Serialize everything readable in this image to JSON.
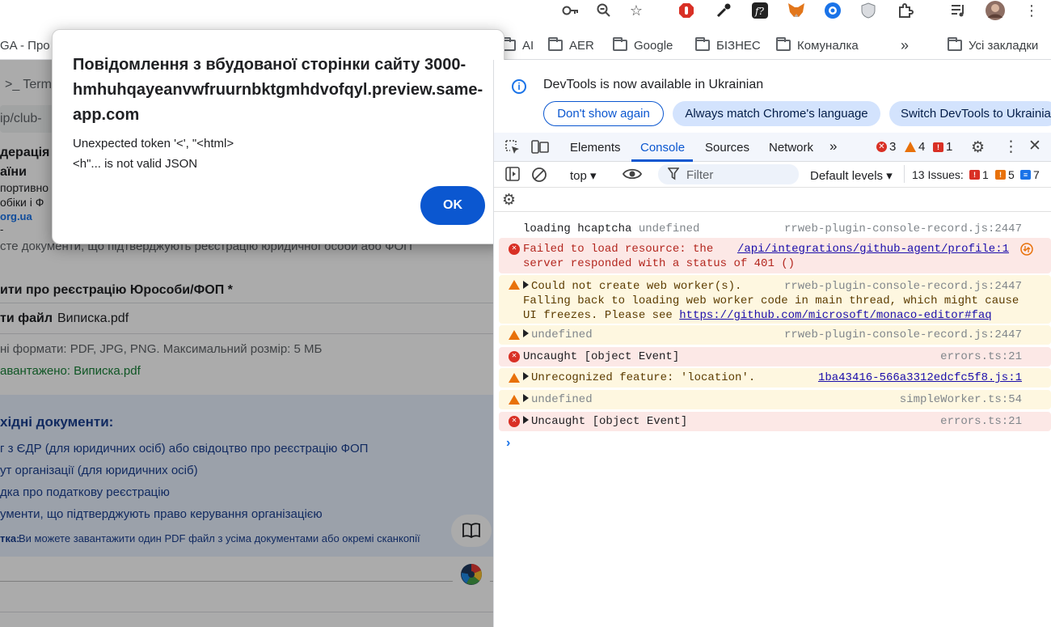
{
  "bookmarks": {
    "partial_left": "GA - Про",
    "items": [
      "AI",
      "AER",
      "Google",
      "БІЗНЕС",
      "Комуналка"
    ],
    "overflow": "»",
    "all": "Усі закладки"
  },
  "left_page": {
    "terminal_tab": ">_ Term",
    "url_partial": "ip/club-",
    "org_line1": "дерація",
    "org_line2": "аїни",
    "org_line3": "портивно",
    "org_line4": "обіки і Ф",
    "org_link": "org.ua",
    "dash": "-",
    "desc": "сте документи, що підтверджують реєстрацію юридичної особи або ФОП",
    "field_label": "ити про реєстрацію Юрособи/ФОП *",
    "file_label": "ти файл",
    "file_name": "Виписка.pdf",
    "formats": "ні формати: PDF, JPG, PNG. Максимальний розмір: 5 МБ",
    "uploaded": "авантажено: Виписка.pdf",
    "required_title": "хідні документи:",
    "req_items": [
      "г з ЄДР (для юридичних осіб) або свідоцтво про реєстрацію ФОП",
      "ут організації (для юридичних осіб)",
      "дка про податкову реєстрацію",
      "ументи, що підтверджують право керування організацією"
    ],
    "note_bold": "тка:",
    "note_text": "Ви можете завантажити один PDF файл з усіма документами або окремі сканкопії"
  },
  "dialog": {
    "title": "Повідомлення з вбудованої сторінки сайту 3000-hmhuhqayeanvwfruurnbktgmhdvofqyl.preview.same-app.com",
    "message": "Unexpected token '<', \"<html>\n<h\"... is not valid JSON",
    "ok_label": "OK"
  },
  "devtools": {
    "info_text": "DevTools is now available in Ukrainian",
    "btn_dont_show": "Don't show again",
    "btn_always_match": "Always match Chrome's language",
    "btn_switch": "Switch DevTools to Ukrainian",
    "tabs": [
      "Elements",
      "Console",
      "Sources",
      "Network"
    ],
    "active_tab": "Console",
    "error_count": "3",
    "warning_count": "4",
    "issue_count": "1",
    "context": "top",
    "filter_placeholder": "Filter",
    "levels": "Default levels",
    "issues_label": "13 Issues:",
    "issues_red": "1",
    "issues_orange": "5",
    "issues_blue": "7"
  },
  "console": [
    {
      "level": "info",
      "text": "loading hcaptcha",
      "grey": "undefined",
      "source": "rrweb-plugin-console-record.js:2447"
    },
    {
      "level": "error",
      "text": "Failed to load resource: the",
      "text2": "server responded with a status of 401 ()",
      "link": "/api/integrations/github-agent/profile:1"
    },
    {
      "level": "warn",
      "text": "Could not create web worker(s).",
      "text2": "Falling back to loading web worker code in main thread, which might cause",
      "text3": "UI freezes. Please see ",
      "link": "https://github.com/microsoft/monaco-editor#faq",
      "source": "rrweb-plugin-console-record.js:2447"
    },
    {
      "level": "warn",
      "grey": "undefined",
      "source": "rrweb-plugin-console-record.js:2447"
    },
    {
      "level": "error",
      "text": "Uncaught [object Event]",
      "source": "errors.ts:21"
    },
    {
      "level": "warn",
      "text": "Unrecognized feature: 'location'.",
      "link": "1ba43416-566a3312edcfc5f8.js:1"
    },
    {
      "level": "warn",
      "grey": "undefined",
      "source": "simpleWorker.ts:54"
    },
    {
      "level": "error",
      "text": "Uncaught [object Event]",
      "source": "errors.ts:21"
    }
  ],
  "colors": {
    "accent": "#0b57d0",
    "error": "#d93025",
    "warning": "#e8710a",
    "error_bg": "#fce8e6",
    "warning_bg": "#fef7e0"
  }
}
